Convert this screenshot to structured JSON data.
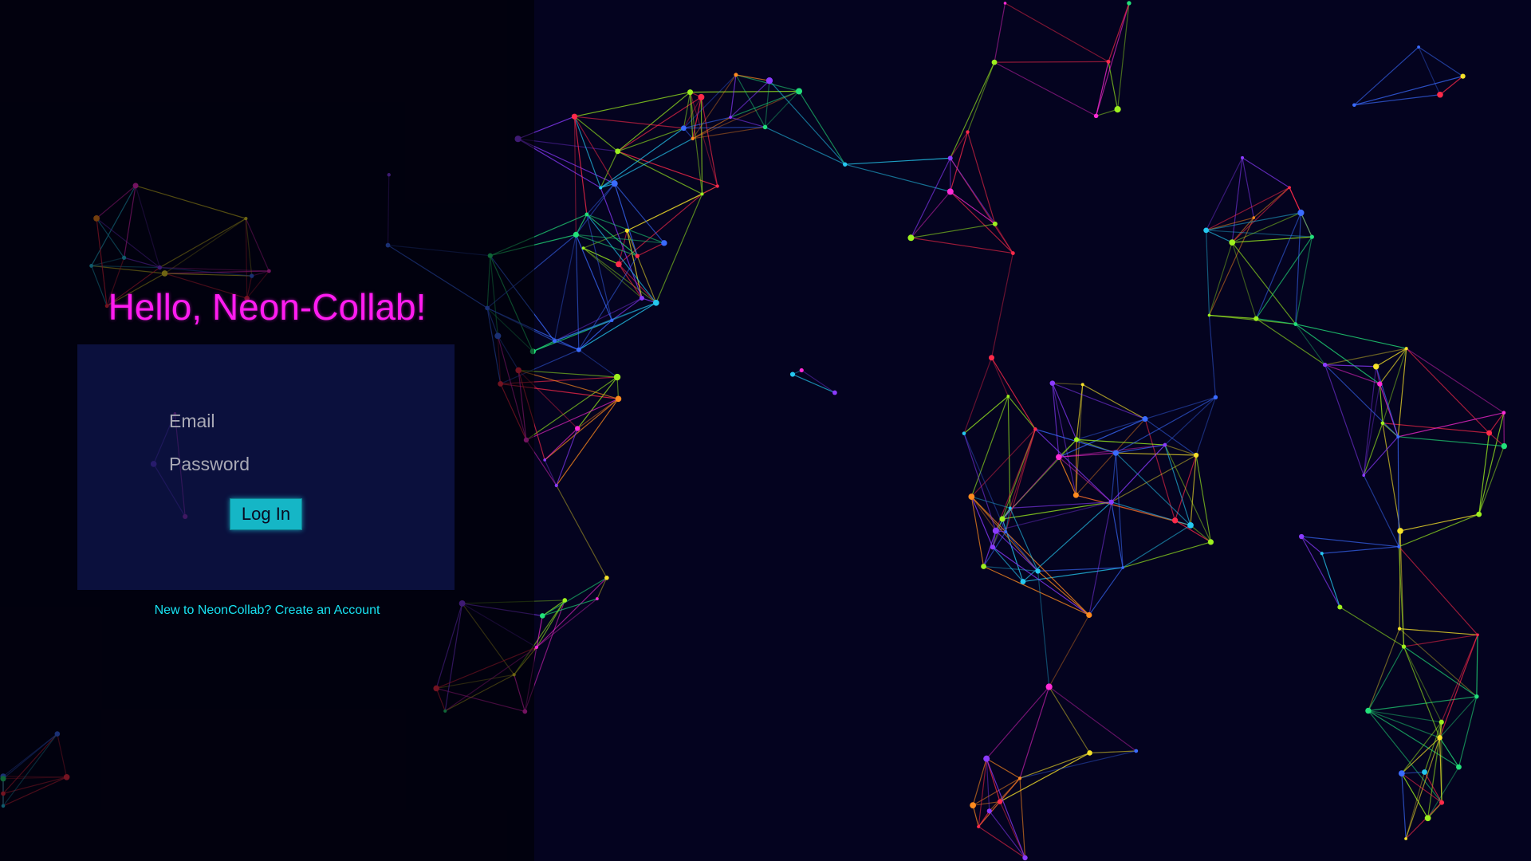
{
  "greeting": "Hello, Neon-Collab!",
  "login": {
    "email_placeholder": "Email",
    "password_placeholder": "Password",
    "button_label": "Log In"
  },
  "signup_link": "New to NeonCollab? Create an Account",
  "colors": {
    "background": "#04031f",
    "greeting": "#ff1cf0",
    "accent": "#15b6c6",
    "link": "#18e2f2"
  }
}
